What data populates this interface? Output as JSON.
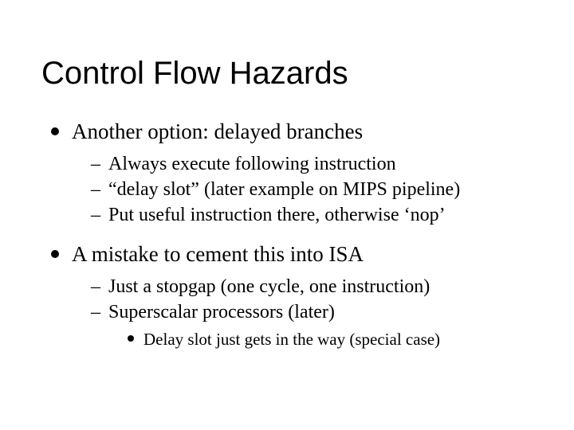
{
  "title": "Control Flow Hazards",
  "items": [
    {
      "text": "Another option: delayed branches",
      "sub": [
        {
          "text": "Always execute following instruction"
        },
        {
          "text": "“delay slot” (later example on MIPS pipeline)"
        },
        {
          "text": "Put useful instruction there, otherwise ‘nop’"
        }
      ]
    },
    {
      "text": "A mistake to cement this into ISA",
      "sub": [
        {
          "text": "Just a stopgap (one cycle, one instruction)"
        },
        {
          "text": "Superscalar processors (later)",
          "sub": [
            {
              "text": "Delay slot just gets in the way (special case)"
            }
          ]
        }
      ]
    }
  ]
}
